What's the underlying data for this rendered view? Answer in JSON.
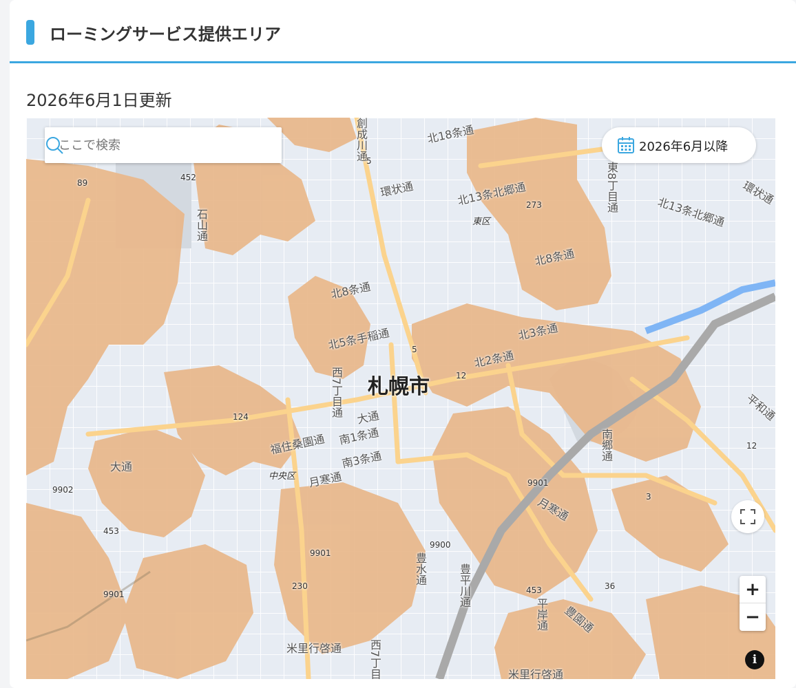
{
  "header": {
    "title": "ローミングサービス提供エリア"
  },
  "updated_text": "2026年6月1日更新",
  "search": {
    "placeholder": "ここで検索",
    "icon": "search-icon"
  },
  "date_filter": {
    "label": "2026年6月以降",
    "icon": "calendar-icon"
  },
  "controls": {
    "zoom_in": "+",
    "zoom_out": "−",
    "info": "i",
    "fullscreen_icon": "fullscreen-icon"
  },
  "colors": {
    "accent": "#3ba7e0",
    "coverage": "#e9b78a",
    "map_background": "#e7ecf3"
  },
  "map": {
    "city": "札幌市",
    "wards": [
      "東区",
      "中央区"
    ],
    "road_labels": [
      "北18条通",
      "環状通",
      "北13条北郷通",
      "北13条北郷通",
      "北8条通",
      "北8条通",
      "北5条手稲通",
      "北3条通",
      "北2条通",
      "大通",
      "南1条通",
      "福住桑園通",
      "南3条通",
      "月寒通",
      "大通",
      "月寒通",
      "米里行啓通",
      "米里行啓通",
      "環状通",
      "平和通",
      "豊平川通",
      "豊水通",
      "平岸通",
      "南郷通",
      "豊園通",
      "石山通",
      "西7丁目通",
      "西7丁目通",
      "創成川通",
      "東8丁目通"
    ],
    "route_numbers": [
      "5",
      "5",
      "12",
      "273",
      "124",
      "89",
      "452",
      "453",
      "230",
      "36",
      "3",
      "12",
      "9901",
      "9901",
      "9901",
      "9902",
      "9900",
      "453"
    ]
  }
}
